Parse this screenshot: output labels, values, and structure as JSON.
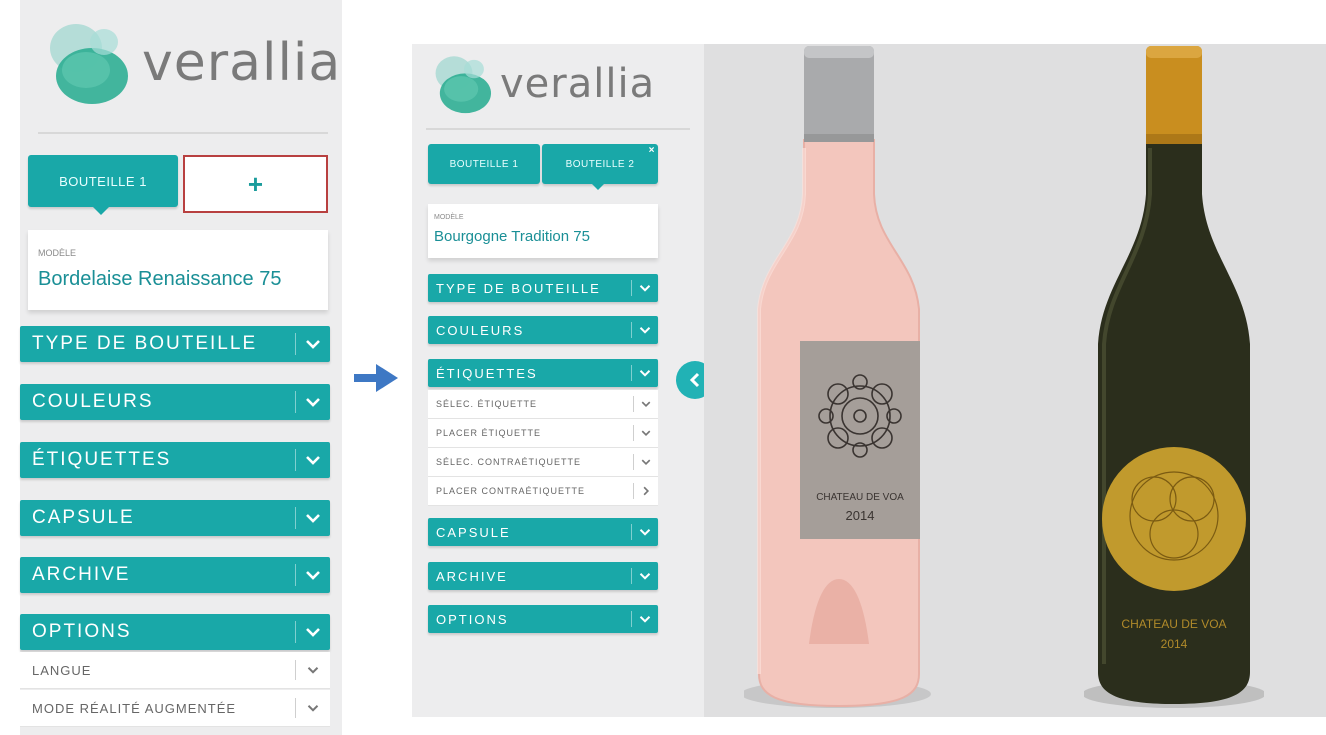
{
  "left": {
    "brand": "verallia",
    "tabs": {
      "bottle1": "BOUTEILLE 1",
      "add": "+"
    },
    "model": {
      "label": "MODÈLE",
      "value": "Bordelaise Renaissance 75"
    },
    "sections": [
      "TYPE DE BOUTEILLE",
      "COULEURS",
      "ÉTIQUETTES",
      "CAPSULE",
      "ARCHIVE",
      "OPTIONS"
    ],
    "options_items": [
      "LANGUE",
      "MODE RÉALITÉ AUGMENTÉE"
    ]
  },
  "right": {
    "brand": "verallia",
    "tabs": {
      "bottle1": "BOUTEILLE 1",
      "bottle2": "BOUTEILLE 2",
      "close": "×"
    },
    "model": {
      "label": "MODÈLE",
      "value": "Bourgogne Tradition 75"
    },
    "sections_top": [
      "TYPE DE BOUTEILLE",
      "COULEURS",
      "ÉTIQUETTES"
    ],
    "etiquettes_items": [
      "SÉLEC. ÉTIQUETTE",
      "PLACER ÉTIQUETTE",
      "SÉLEC. CONTRAÉTIQUETTE",
      "PLACER CONTRAÉTIQUETTE"
    ],
    "sections_bottom": [
      "CAPSULE",
      "ARCHIVE",
      "OPTIONS"
    ]
  },
  "bottles": [
    {
      "label_line1": "CHATEAU DE VOA",
      "label_line2": "2014",
      "glass": "#f3c6bd",
      "capsule": "#a9aaac",
      "label_bg": "#a59e99"
    },
    {
      "label_line1": "CHATEAU DE VOA",
      "label_line2": "2014",
      "glass": "#2b2e1c",
      "capsule": "#c98e1f",
      "label_bg": "#c19a2d"
    }
  ],
  "colors": {
    "accent": "#19a8a8",
    "arrow": "#3e78c4"
  }
}
